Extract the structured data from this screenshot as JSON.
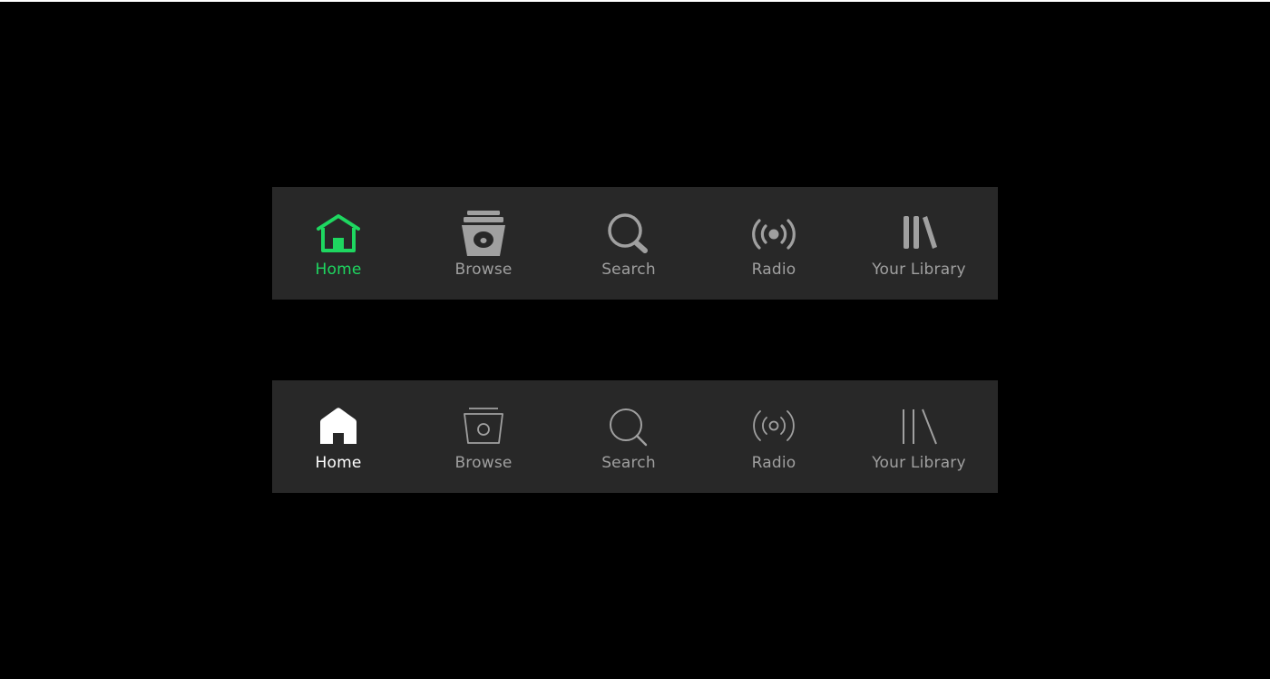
{
  "colors": {
    "background": "#000000",
    "bar": "#282828",
    "accent_green": "#1ed760",
    "inactive": "#a0a0a0",
    "active_white": "#ffffff"
  },
  "bar1": {
    "style": "filled",
    "tabs": [
      {
        "label": "Home",
        "icon": "home-icon",
        "state": "active"
      },
      {
        "label": "Browse",
        "icon": "browse-icon",
        "state": "inactive"
      },
      {
        "label": "Search",
        "icon": "search-icon",
        "state": "inactive"
      },
      {
        "label": "Radio",
        "icon": "radio-icon",
        "state": "inactive"
      },
      {
        "label": "Your Library",
        "icon": "library-icon",
        "state": "inactive"
      }
    ]
  },
  "bar2": {
    "style": "outline",
    "tabs": [
      {
        "label": "Home",
        "icon": "home-icon",
        "state": "active"
      },
      {
        "label": "Browse",
        "icon": "browse-icon",
        "state": "inactive"
      },
      {
        "label": "Search",
        "icon": "search-icon",
        "state": "inactive"
      },
      {
        "label": "Radio",
        "icon": "radio-icon",
        "state": "inactive"
      },
      {
        "label": "Your Library",
        "icon": "library-icon",
        "state": "inactive"
      }
    ]
  }
}
